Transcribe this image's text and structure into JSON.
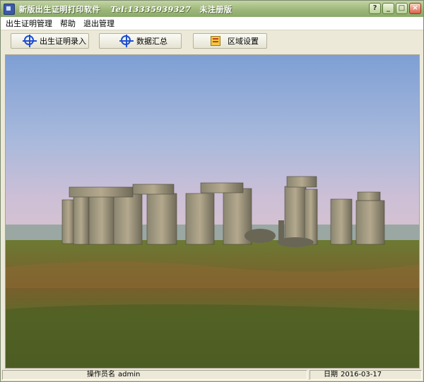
{
  "window": {
    "title": "新版出生证明打印软件",
    "phone": "Tel:13335939327",
    "reg_status": "未注册版",
    "controls": {
      "help": "?",
      "minimize": "_",
      "maximize": "□",
      "close": "×"
    }
  },
  "menu": {
    "items": [
      {
        "label": "出生证明管理"
      },
      {
        "label": "帮助"
      },
      {
        "label": "退出管理"
      }
    ]
  },
  "toolbar": {
    "buttons": [
      {
        "label": "出生证明录入",
        "icon": "crosshair-icon"
      },
      {
        "label": "数据汇总",
        "icon": "crosshair-icon"
      },
      {
        "label": "区域设置",
        "icon": "folder-icon"
      }
    ]
  },
  "statusbar": {
    "operator_label": "操作员名",
    "operator_value": "admin",
    "date_label": "日期",
    "date_value": "2016-03-17"
  },
  "colors": {
    "titlebar": "#9db77a",
    "accent": "#1f4fd1"
  }
}
